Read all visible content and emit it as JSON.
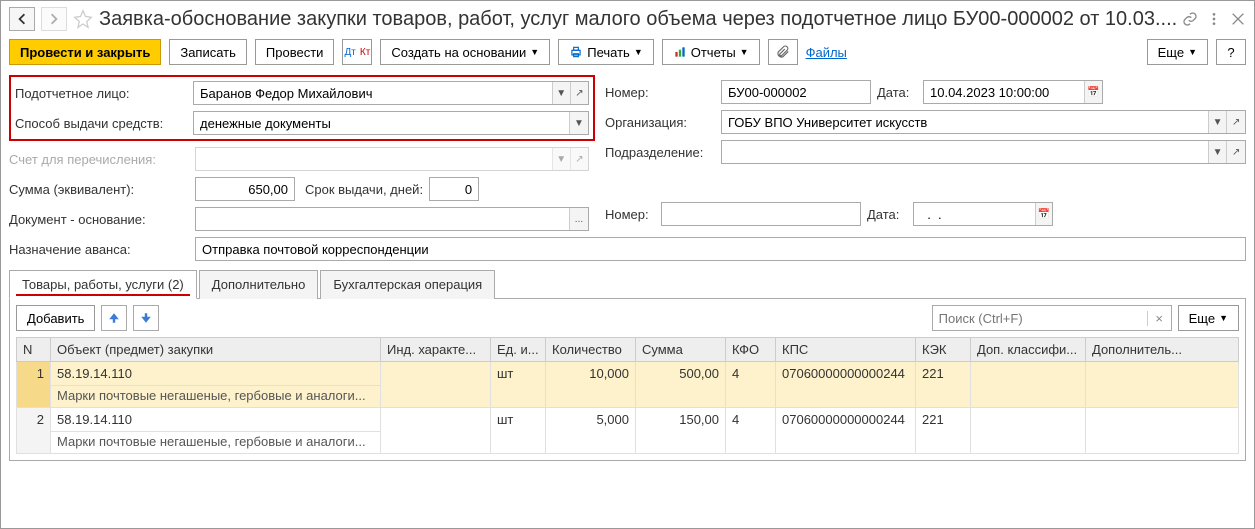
{
  "title": "Заявка-обоснование закупки товаров, работ, услуг малого объема через подотчетное лицо БУ00-000002 от 10.03....",
  "toolbar": {
    "post_close": "Провести и закрыть",
    "write": "Записать",
    "post": "Провести",
    "create_based": "Создать на основании",
    "print": "Печать",
    "reports": "Отчеты",
    "files": "Файлы",
    "more": "Еще"
  },
  "labels": {
    "accountable": "Подотчетное лицо:",
    "issue_method": "Способ выдачи средств:",
    "transfer_account": "Счет для перечисления:",
    "sum_equiv": "Сумма (эквивалент):",
    "issue_days": "Срок выдачи, дней:",
    "basis_doc": "Документ - основание:",
    "advance_purpose": "Назначение аванса:",
    "number": "Номер:",
    "date": "Дата:",
    "org": "Организация:",
    "dept": "Подразделение:",
    "number2": "Номер:",
    "date2": "Дата:"
  },
  "values": {
    "accountable": "Баранов Федор Михайлович",
    "issue_method": "денежные документы",
    "transfer_account": "",
    "sum_equiv": "650,00",
    "issue_days": "0",
    "basis_doc": "",
    "advance_purpose": "Отправка почтовой корреспонденции",
    "number": "БУ00-000002",
    "date": "10.04.2023 10:00:00",
    "org": "ГОБУ ВПО Университет искусств",
    "dept": "",
    "number2": "",
    "date2": "  .  .    "
  },
  "tabs": {
    "main": "Товары, работы, услуги (2)",
    "extra": "Дополнительно",
    "acc": "Бухгалтерская операция"
  },
  "subtoolbar": {
    "add": "Добавить",
    "search_placeholder": "Поиск (Ctrl+F)",
    "more": "Еще"
  },
  "columns": {
    "n": "N",
    "object": "Объект (предмет) закупки",
    "ind": "Инд. характе...",
    "unit": "Ед. и...",
    "qty": "Количество",
    "sum": "Сумма",
    "kfo": "КФО",
    "kps": "КПС",
    "kek": "КЭК",
    "dop": "Доп. классифи...",
    "extra": "Дополнитель..."
  },
  "rows": [
    {
      "n": "1",
      "code": "58.19.14.110",
      "name": "Марки почтовые негашеные, гербовые и аналоги...",
      "ind": "",
      "unit": "шт",
      "qty": "10,000",
      "sum": "500,00",
      "kfo": "4",
      "kps": "07060000000000244",
      "kek": "221",
      "dop": "",
      "extra": ""
    },
    {
      "n": "2",
      "code": "58.19.14.110",
      "name": "Марки почтовые негашеные, гербовые и аналоги...",
      "ind": "",
      "unit": "шт",
      "qty": "5,000",
      "sum": "150,00",
      "kfo": "4",
      "kps": "07060000000000244",
      "kek": "221",
      "dop": "",
      "extra": ""
    }
  ]
}
